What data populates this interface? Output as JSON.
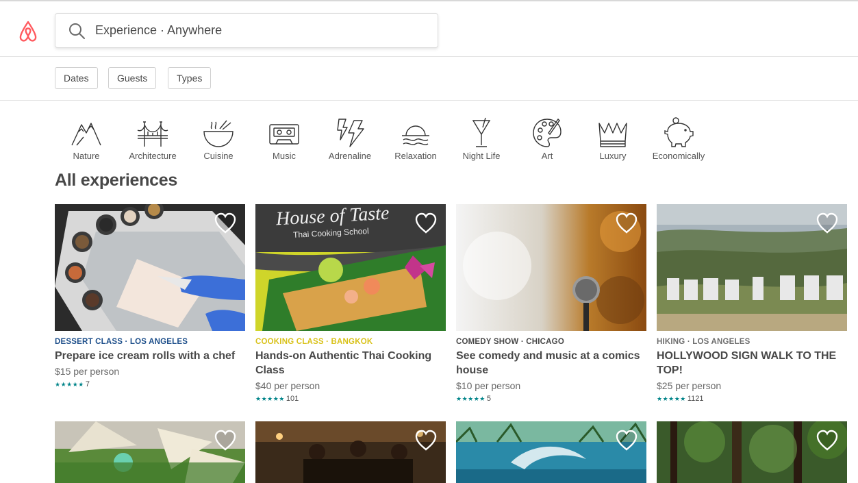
{
  "search": {
    "placeholder": "Experience · Anywhere"
  },
  "filters": [
    {
      "label": "Dates"
    },
    {
      "label": "Guests"
    },
    {
      "label": "Types"
    }
  ],
  "categories": [
    {
      "label": "Nature",
      "icon": "mountains-icon"
    },
    {
      "label": "Architecture",
      "icon": "bridge-icon"
    },
    {
      "label": "Cuisine",
      "icon": "bowl-icon"
    },
    {
      "label": "Music",
      "icon": "cassette-icon"
    },
    {
      "label": "Adrenaline",
      "icon": "lightning-icon"
    },
    {
      "label": "Relaxation",
      "icon": "sunset-icon"
    },
    {
      "label": "Night Life",
      "icon": "cocktail-icon"
    },
    {
      "label": "Art",
      "icon": "palette-icon"
    },
    {
      "label": "Luxury",
      "icon": "crown-icon"
    },
    {
      "label": "Economically",
      "icon": "piggy-bank-icon"
    }
  ],
  "section_title": "All experiences",
  "colors": {
    "brand": "#FF5A5F",
    "rating": "#008489",
    "dessert": "#1C4E8A",
    "cooking": "#D9C21A",
    "dark": "#484848"
  },
  "cards": [
    {
      "kicker": "DESSERT CLASS · LOS ANGELES",
      "kicker_color": "#1C4E8A",
      "title": "Prepare ice cream rolls with a chef",
      "price": "$15 per person",
      "stars": "★★★★★",
      "reviews": "7"
    },
    {
      "kicker": "COOKING CLASS · BANGKOK",
      "kicker_color": "#D9C21A",
      "title": "Hands-on Authentic Thai Cooking Class",
      "price": "$40 per person",
      "stars": "★★★★★",
      "reviews": "101",
      "image_text": {
        "line1": "House of Taste",
        "line2": "Thai Cooking School"
      }
    },
    {
      "kicker": "COMEDY SHOW · CHICAGO",
      "kicker_color": "#484848",
      "title": "See comedy and music at a comics house",
      "price": "$10 per person",
      "stars": "★★★★★",
      "reviews": "5"
    },
    {
      "kicker": "HIKING · LOS ANGELES",
      "kicker_color": "#6E6E6E",
      "title": "HOLLYWOOD SIGN WALK TO THE TOP!",
      "price": "$25 per person",
      "stars": "★★★★★",
      "reviews": "1121"
    }
  ]
}
